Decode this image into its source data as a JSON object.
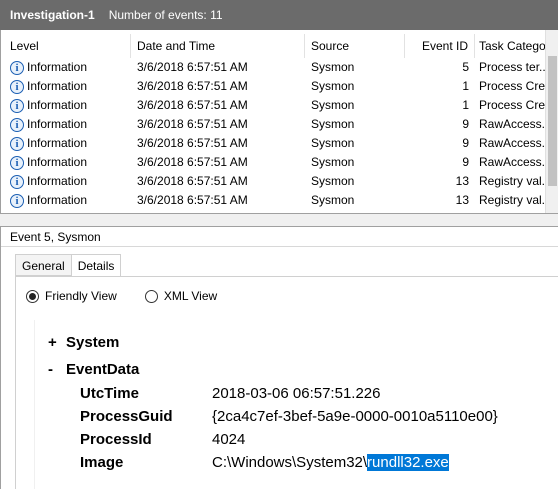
{
  "window": {
    "title": "Investigation-1",
    "event_count_label": "Number of events: 11"
  },
  "columns": {
    "level": "Level",
    "date": "Date and Time",
    "source": "Source",
    "event_id": "Event ID",
    "task": "Task Catego..."
  },
  "rows": [
    {
      "level": "Information",
      "date": "3/6/2018 6:57:51 AM",
      "source": "Sysmon",
      "event_id": "5",
      "task": "Process ter..."
    },
    {
      "level": "Information",
      "date": "3/6/2018 6:57:51 AM",
      "source": "Sysmon",
      "event_id": "1",
      "task": "Process Cre..."
    },
    {
      "level": "Information",
      "date": "3/6/2018 6:57:51 AM",
      "source": "Sysmon",
      "event_id": "1",
      "task": "Process Cre..."
    },
    {
      "level": "Information",
      "date": "3/6/2018 6:57:51 AM",
      "source": "Sysmon",
      "event_id": "9",
      "task": "RawAccess..."
    },
    {
      "level": "Information",
      "date": "3/6/2018 6:57:51 AM",
      "source": "Sysmon",
      "event_id": "9",
      "task": "RawAccess..."
    },
    {
      "level": "Information",
      "date": "3/6/2018 6:57:51 AM",
      "source": "Sysmon",
      "event_id": "9",
      "task": "RawAccess..."
    },
    {
      "level": "Information",
      "date": "3/6/2018 6:57:51 AM",
      "source": "Sysmon",
      "event_id": "13",
      "task": "Registry val..."
    },
    {
      "level": "Information",
      "date": "3/6/2018 6:57:51 AM",
      "source": "Sysmon",
      "event_id": "13",
      "task": "Registry val..."
    }
  ],
  "detail": {
    "header": "Event 5, Sysmon",
    "tabs": [
      "General",
      "Details"
    ],
    "view_options": [
      "Friendly View",
      "XML View"
    ],
    "selected_view": "Friendly View",
    "system_node": {
      "toggle": "+",
      "label": "System"
    },
    "eventdata_node": {
      "toggle": "-",
      "label": "EventData"
    },
    "fields": [
      {
        "name": "UtcTime",
        "value": "2018-03-06 06:57:51.226"
      },
      {
        "name": "ProcessGuid",
        "value": "{2ca4c7ef-3bef-5a9e-0000-0010a5110e00}"
      },
      {
        "name": "ProcessId",
        "value": "4024"
      }
    ],
    "image_field": {
      "name": "Image",
      "value_prefix": "C:\\Windows\\System32\\",
      "value_selected": "rundll32.exe"
    }
  }
}
